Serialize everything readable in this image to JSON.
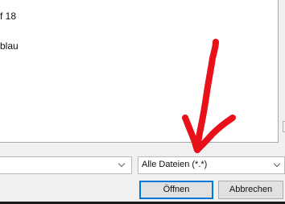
{
  "file_list": {
    "row1_text": "f 18",
    "row2_text": "blau"
  },
  "filename_combo": {
    "value": ""
  },
  "filetype_combo": {
    "value": "Alle Dateien (*.*)"
  },
  "buttons": {
    "open_label": "Öffnen",
    "cancel_label": "Abbrechen"
  },
  "annotation": {
    "type": "red hand-drawn arrow pointing down",
    "color": "#e8111a"
  }
}
